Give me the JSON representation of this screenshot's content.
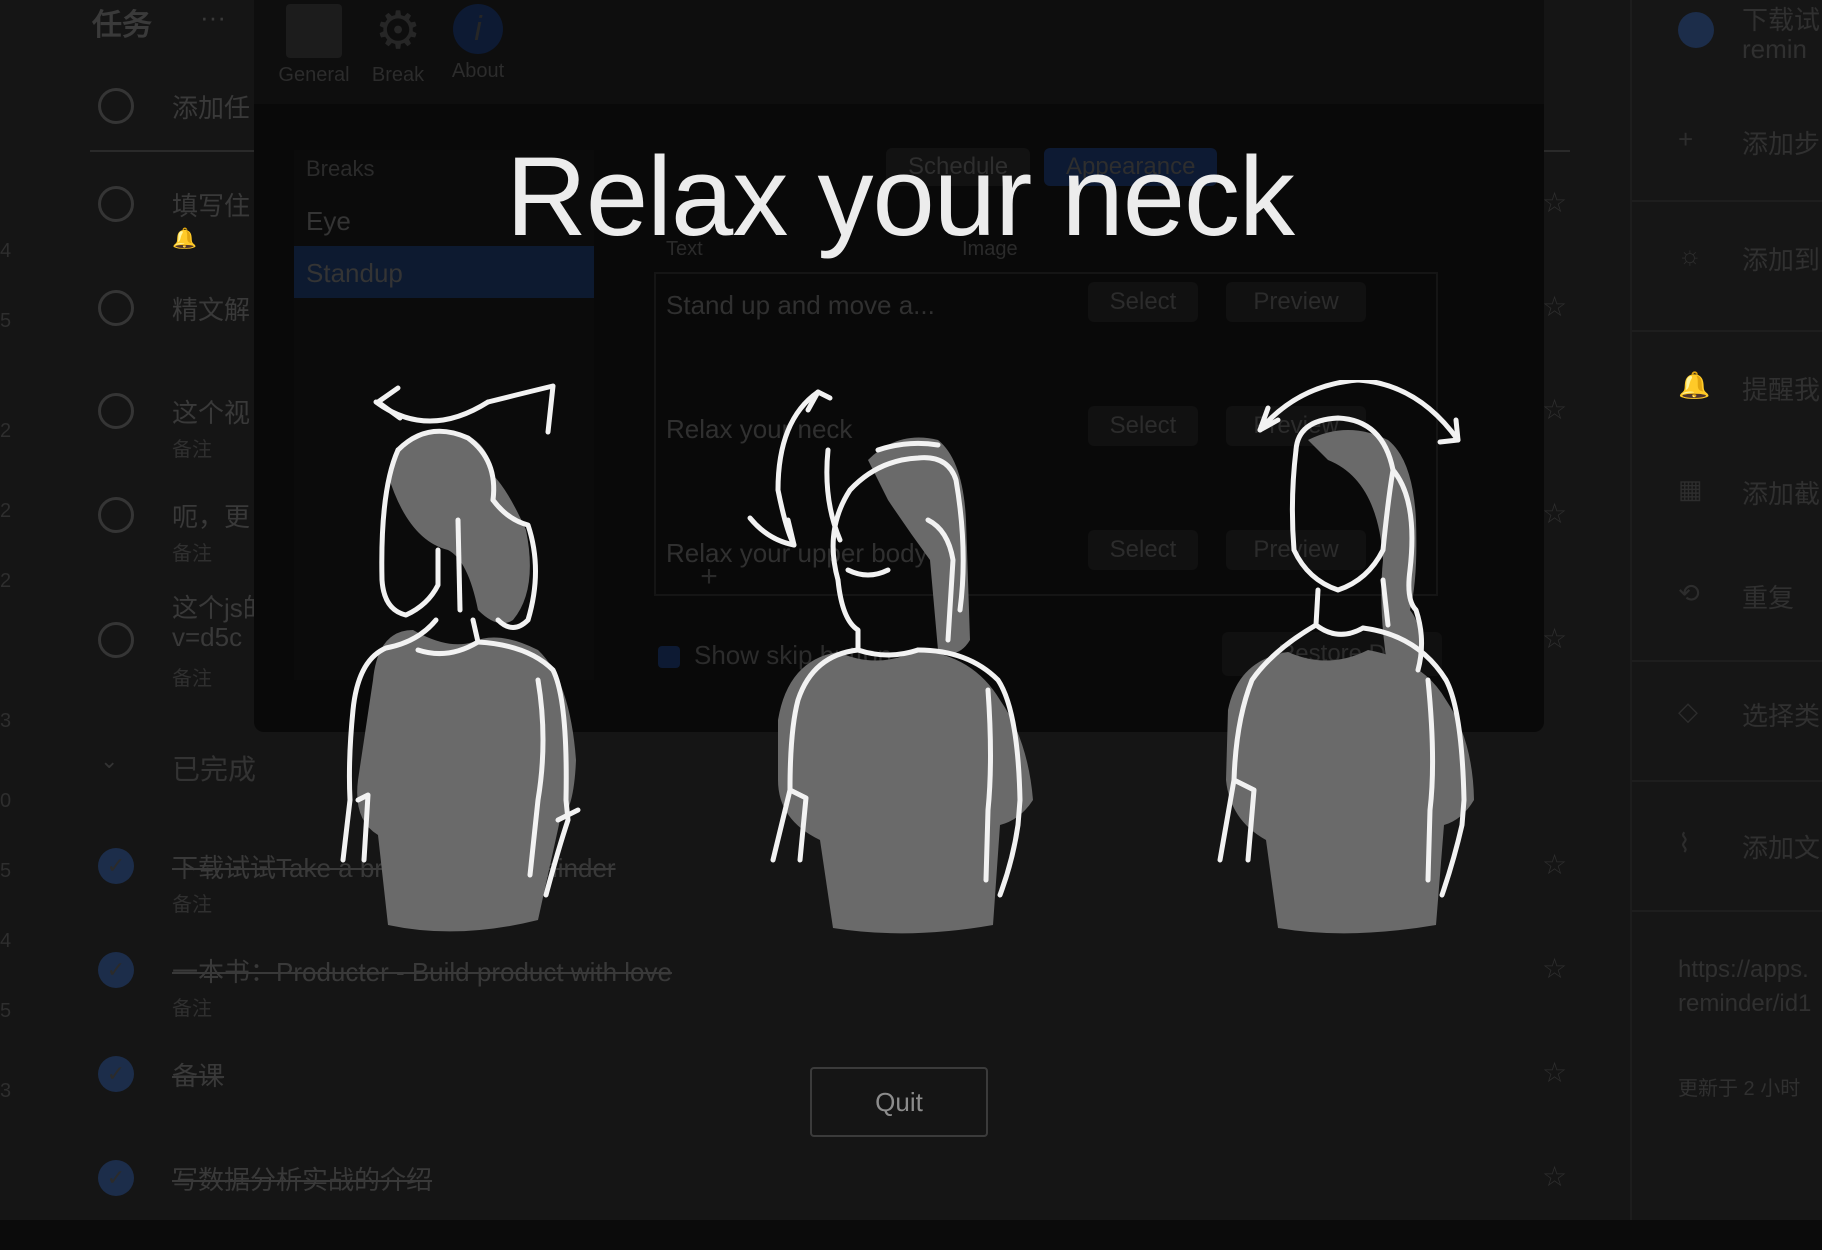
{
  "todo": {
    "title": "任务",
    "menu_dots": "···",
    "left_numbers": [
      "4",
      "5",
      "2",
      "2",
      "2",
      "3",
      "0",
      "5",
      "4",
      "5",
      "3"
    ],
    "add_task_placeholder": "添加任",
    "rows": [
      {
        "text": "填写住",
        "note": "",
        "status": "open"
      },
      {
        "text": "精文解",
        "note": "",
        "status": "open"
      },
      {
        "text": "这个视",
        "note": "备注",
        "status": "open"
      },
      {
        "text": "呃，更",
        "note": "备注",
        "status": "open"
      },
      {
        "text": "这个js的",
        "note": "备注",
        "text2": "v=d5c",
        "status": "open"
      }
    ],
    "completed_label": "已完成",
    "completed": [
      {
        "text": "下载试试Take a break - timer reminder",
        "note": "备注"
      },
      {
        "text": "一本书：Producter - Build product with love",
        "note": "备注"
      },
      {
        "text": "备课",
        "note": ""
      },
      {
        "text": "写数据分析实战的介绍",
        "note": ""
      }
    ]
  },
  "detail": {
    "task_title_line1": "下载试",
    "task_title_line2": "remin",
    "items": [
      {
        "icon": "plus-icon",
        "label": "添加步"
      },
      {
        "icon": "sun-icon",
        "label": "添加到"
      },
      {
        "icon": "bell-icon",
        "label": "提醒我"
      },
      {
        "icon": "calendar-icon",
        "label": "添加截"
      },
      {
        "icon": "repeat-icon",
        "label": "重复"
      },
      {
        "icon": "tag-icon",
        "label": "选择类"
      },
      {
        "icon": "paperclip-icon",
        "label": "添加文"
      }
    ],
    "link_line1": "https://apps.",
    "link_line2": "reminder/id1",
    "updated": "更新于 2 小时"
  },
  "settings": {
    "tabs": [
      {
        "label": "General",
        "icon": "general-icon"
      },
      {
        "label": "Break",
        "icon": "gear-icon"
      },
      {
        "label": "About",
        "icon": "info-icon"
      }
    ],
    "sidebar_header": "Breaks",
    "sidebar_items": [
      "Eye",
      "Standup"
    ],
    "segments": [
      "Schedule",
      "Appearance"
    ],
    "columns": {
      "text": "Text",
      "image": "Image"
    },
    "rows": [
      {
        "text": "Stand up and move a...",
        "select": "Select",
        "preview": "Preview"
      },
      {
        "text": "Relax your neck",
        "select": "Select",
        "preview": "Preview"
      },
      {
        "text": "Relax your upper body",
        "select": "Select",
        "preview": "Preview"
      }
    ],
    "add_symbol": "+",
    "show_skip_label": "Show skip button",
    "restore_label": "Restore D"
  },
  "overlay": {
    "title": "Relax your neck",
    "quit_label": "Quit"
  },
  "colors": {
    "overlay_text": "#ececec",
    "figure_fill": "#6a6a6a",
    "figure_stroke": "#f2f2f2",
    "accent_blue": "#1c2d4a"
  }
}
